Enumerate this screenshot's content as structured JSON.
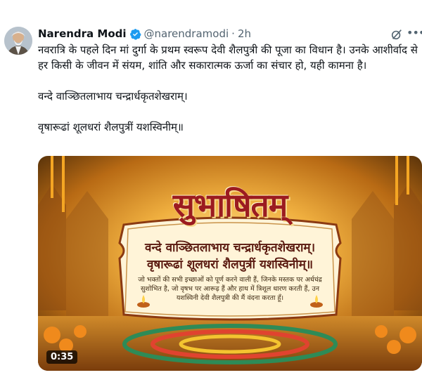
{
  "tweet": {
    "author_name": "Narendra Modi",
    "handle": "@narendramodi",
    "separator": "·",
    "time": "2h",
    "text": [
      "नवरात्रि के पहले दिन मां दुर्गा के प्रथम स्वरूप देवी शैलपुत्री की पूजा का विधान है। उनके आशीर्वाद से हर किसी के जीवन में संयम, शांति और सकारात्मक ऊर्जा का संचार हो, यही कामना है।",
      "वन्दे वाञ्छितलाभाय चन्द्रार्धकृतशेखराम्।",
      "वृषारूढां शूलधरां शैलपुत्रीं यशस्विनीम्॥"
    ]
  },
  "media": {
    "title": "सुभाषितम्",
    "verse_line_1": "वन्दे वाञ्छितलाभाय चन्द्रार्धकृतशेखराम्।",
    "verse_line_2": "वृषारूढां शूलधरां शैलपुत्रीं यशस्विनीम्॥",
    "meaning": "जो भक्तों की सभी इच्छाओं को पूर्ण करने वाली हैं, जिनके मस्तक पर अर्धचंद्र सुशोभित है, जो वृषभ पर आरूढ़ हैं और हाथ में त्रिशूल धारण करती हैं, उन यशस्विनी देवी शैलपुत्री की मैं वंदना करता हूँ।",
    "duration": "0:35"
  },
  "icons": {
    "verified": "verified-badge-icon",
    "grok": "grok-icon",
    "more": "more-options-icon"
  },
  "colors": {
    "verified_blue": "#1d9bf0",
    "text_primary": "#0f1419",
    "text_secondary": "#536471",
    "title_red": "#9b1b20"
  }
}
